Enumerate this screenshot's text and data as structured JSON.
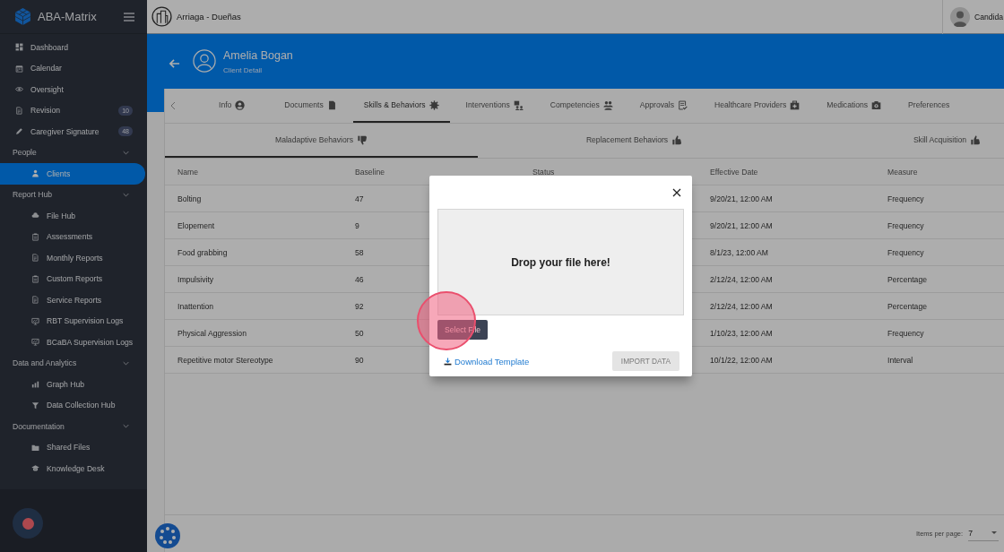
{
  "app": {
    "name": "ABA-Matrix"
  },
  "sidebar": {
    "items": [
      {
        "kind": "link",
        "label": "Dashboard",
        "selected": false
      },
      {
        "kind": "link",
        "label": "Calendar",
        "selected": false
      },
      {
        "kind": "link",
        "label": "Oversight",
        "selected": false
      },
      {
        "kind": "link",
        "label": "Revision",
        "badge": "10",
        "selected": false
      },
      {
        "kind": "link",
        "label": "Caregiver Signature",
        "badge": "48",
        "selected": false
      },
      {
        "kind": "section",
        "label": "People",
        "expanded": true,
        "children": [
          {
            "kind": "link",
            "label": "Clients",
            "selected": true
          }
        ]
      },
      {
        "kind": "section",
        "label": "Report Hub",
        "expanded": true,
        "children": [
          {
            "kind": "link",
            "label": "File Hub",
            "selected": false
          },
          {
            "kind": "link",
            "label": "Assessments",
            "selected": false
          },
          {
            "kind": "link",
            "label": "Monthly Reports",
            "selected": false
          },
          {
            "kind": "link",
            "label": "Custom Reports",
            "selected": false
          },
          {
            "kind": "link",
            "label": "Service Reports",
            "selected": false
          },
          {
            "kind": "link",
            "label": "RBT Supervision Logs",
            "selected": false
          },
          {
            "kind": "link",
            "label": "BCaBA Supervision Logs",
            "selected": false
          }
        ]
      },
      {
        "kind": "section",
        "label": "Data and Analytics",
        "expanded": true,
        "children": [
          {
            "kind": "link",
            "label": "Graph Hub",
            "selected": false
          },
          {
            "kind": "link",
            "label": "Data Collection Hub",
            "selected": false
          }
        ]
      },
      {
        "kind": "section",
        "label": "Documentation",
        "expanded": true,
        "children": [
          {
            "kind": "link",
            "label": "Shared Files",
            "selected": false
          },
          {
            "kind": "link",
            "label": "Knowledge Desk",
            "selected": false
          }
        ]
      }
    ]
  },
  "top_bar": {
    "organization": "Arriaga - Dueñas",
    "user": "Candida"
  },
  "header": {
    "name": "Amelia Bogan",
    "subtitle": "Client Detail"
  },
  "tabs": [
    {
      "label": "Info",
      "selected": false
    },
    {
      "label": "Documents",
      "selected": false
    },
    {
      "label": "Skills & Behaviors",
      "selected": true
    },
    {
      "label": "Interventions",
      "selected": false
    },
    {
      "label": "Competencies",
      "selected": false
    },
    {
      "label": "Approvals",
      "selected": false
    },
    {
      "label": "Healthcare Providers",
      "selected": false
    },
    {
      "label": "Medications",
      "selected": false
    },
    {
      "label": "Preferences",
      "selected": false
    }
  ],
  "subtabs": [
    {
      "label": "Maladaptive Behaviors",
      "selected": true
    },
    {
      "label": "Replacement Behaviors",
      "selected": false
    },
    {
      "label": "Skill Acquisition",
      "selected": false
    }
  ],
  "table": {
    "columns": [
      "Name",
      "Baseline",
      "Status",
      "Effective Date",
      "Measure"
    ],
    "rows": [
      {
        "name": "Bolting",
        "baseline": "47",
        "effective_date": "9/20/21, 12:00 AM",
        "measure": "Frequency"
      },
      {
        "name": "Elopement",
        "baseline": "9",
        "effective_date": "9/20/21, 12:00 AM",
        "measure": "Frequency"
      },
      {
        "name": "Food grabbing",
        "baseline": "58",
        "effective_date": "8/1/23, 12:00 AM",
        "measure": "Frequency"
      },
      {
        "name": "Impulsivity",
        "baseline": "46",
        "effective_date": "2/12/24, 12:00 AM",
        "measure": "Percentage"
      },
      {
        "name": "Inattention",
        "baseline": "92",
        "effective_date": "2/12/24, 12:00 AM",
        "measure": "Percentage"
      },
      {
        "name": "Physical Aggression",
        "baseline": "50",
        "effective_date": "1/10/23, 12:00 AM",
        "measure": "Frequency"
      },
      {
        "name": "Repetitive motor Stereotype",
        "baseline": "90",
        "effective_date": "10/1/22, 12:00 AM",
        "measure": "Interval"
      }
    ]
  },
  "paginator": {
    "label": "Items per page:",
    "value": "7"
  },
  "dialog": {
    "drop_text": "Drop your file here!",
    "select_button": "Select File",
    "download_link": "Download Template",
    "import_button": {
      "label": "IMPORT DATA",
      "disabled": true
    }
  }
}
